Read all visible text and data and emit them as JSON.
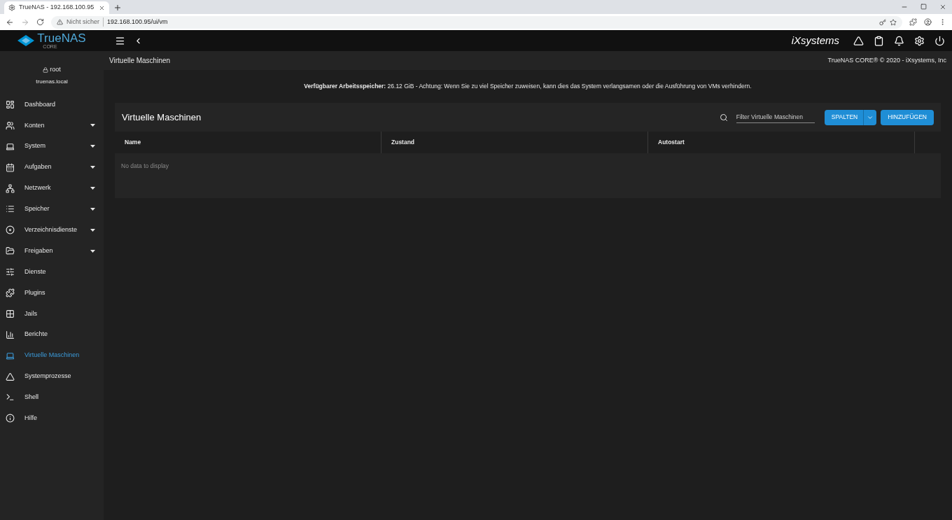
{
  "browser": {
    "tab_title": "TrueNAS - 192.168.100.95",
    "url_warning": "Nicht sicher",
    "url": "192.168.100.95/ui/vm"
  },
  "header": {
    "logo": "TrueNAS",
    "logo_sub": "CORE",
    "brand": "iXsystems"
  },
  "breadcrumb": "Virtuelle Maschinen",
  "copyright": "TrueNAS CORE® © 2020 - iXsystems, Inc",
  "user": {
    "name": "root",
    "host": "truenas.local"
  },
  "sidebar": {
    "items": [
      {
        "label": "Dashboard",
        "has_submenu": false,
        "selected": false
      },
      {
        "label": "Konten",
        "has_submenu": true,
        "selected": false
      },
      {
        "label": "System",
        "has_submenu": true,
        "selected": false
      },
      {
        "label": "Aufgaben",
        "has_submenu": true,
        "selected": false
      },
      {
        "label": "Netzwerk",
        "has_submenu": true,
        "selected": false
      },
      {
        "label": "Speicher",
        "has_submenu": true,
        "selected": false
      },
      {
        "label": "Verzeichnisdienste",
        "has_submenu": true,
        "selected": false
      },
      {
        "label": "Freigaben",
        "has_submenu": true,
        "selected": false
      },
      {
        "label": "Dienste",
        "has_submenu": false,
        "selected": false
      },
      {
        "label": "Plugins",
        "has_submenu": false,
        "selected": false
      },
      {
        "label": "Jails",
        "has_submenu": false,
        "selected": false
      },
      {
        "label": "Berichte",
        "has_submenu": false,
        "selected": false
      },
      {
        "label": "Virtuelle Maschinen",
        "has_submenu": false,
        "selected": true
      },
      {
        "label": "Systemprozesse",
        "has_submenu": false,
        "selected": false
      },
      {
        "label": "Shell",
        "has_submenu": false,
        "selected": false
      },
      {
        "label": "Hilfe",
        "has_submenu": false,
        "selected": false
      }
    ]
  },
  "notice": "**Verfügbarer Arbeitsspeicher:** 26.12 GiB - Achtung: Wenn Sie zu viel Speicher zuweisen, kann dies das System verlangsamen oder die Ausführung von VMs verhindern.",
  "card": {
    "title": "Virtuelle Maschinen",
    "filter": {
      "placeholder": "Filter Virtuelle Maschinen"
    },
    "buttons": [
      "SPALTEN",
      "HINZUFÜGEN"
    ],
    "table": {
      "columns": [
        "Name",
        "Zustand",
        "Autostart"
      ],
      "empty": "No data to display"
    }
  }
}
